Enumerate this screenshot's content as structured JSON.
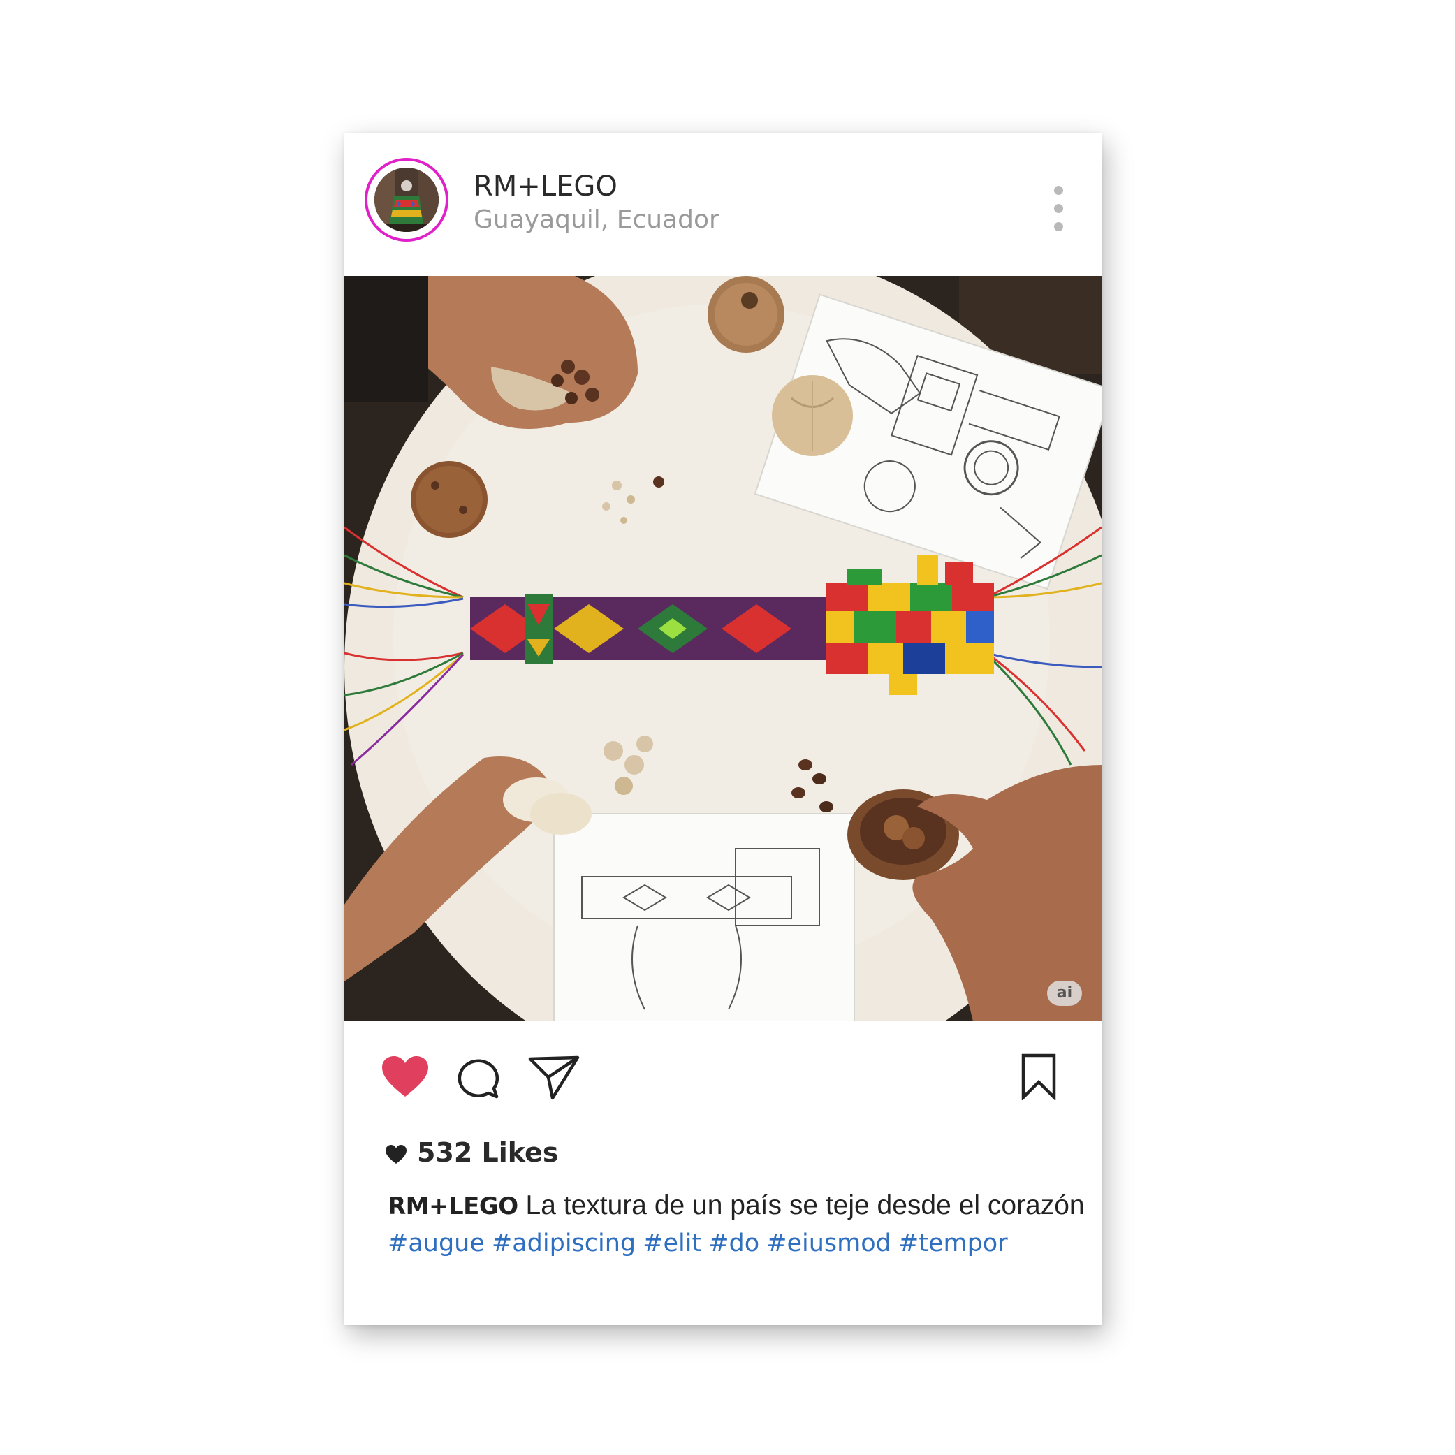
{
  "post": {
    "username": "RM+LEGO",
    "location": "Guayaquil, Ecuador",
    "image_badge": "ai",
    "likes_label": "532 Likes",
    "caption_user": "RM+LEGO",
    "caption_text": " La textura de un país se teje desde el corazón",
    "hashtags": [
      "#augue",
      "#adipiscing",
      "#elit",
      "#do",
      "#eiusmod",
      "#tempor"
    ]
  },
  "colors": {
    "avatar_ring": "#e020c8",
    "like_active": "#e0405e",
    "hashtag": "#2f6fbf",
    "icon": "#222222"
  },
  "icons": {
    "more": "vertical-dots-icon",
    "like": "heart-icon",
    "comment": "comment-bubble-icon",
    "share": "paper-plane-icon",
    "save": "bookmark-icon",
    "likes": "small-heart-icon"
  }
}
